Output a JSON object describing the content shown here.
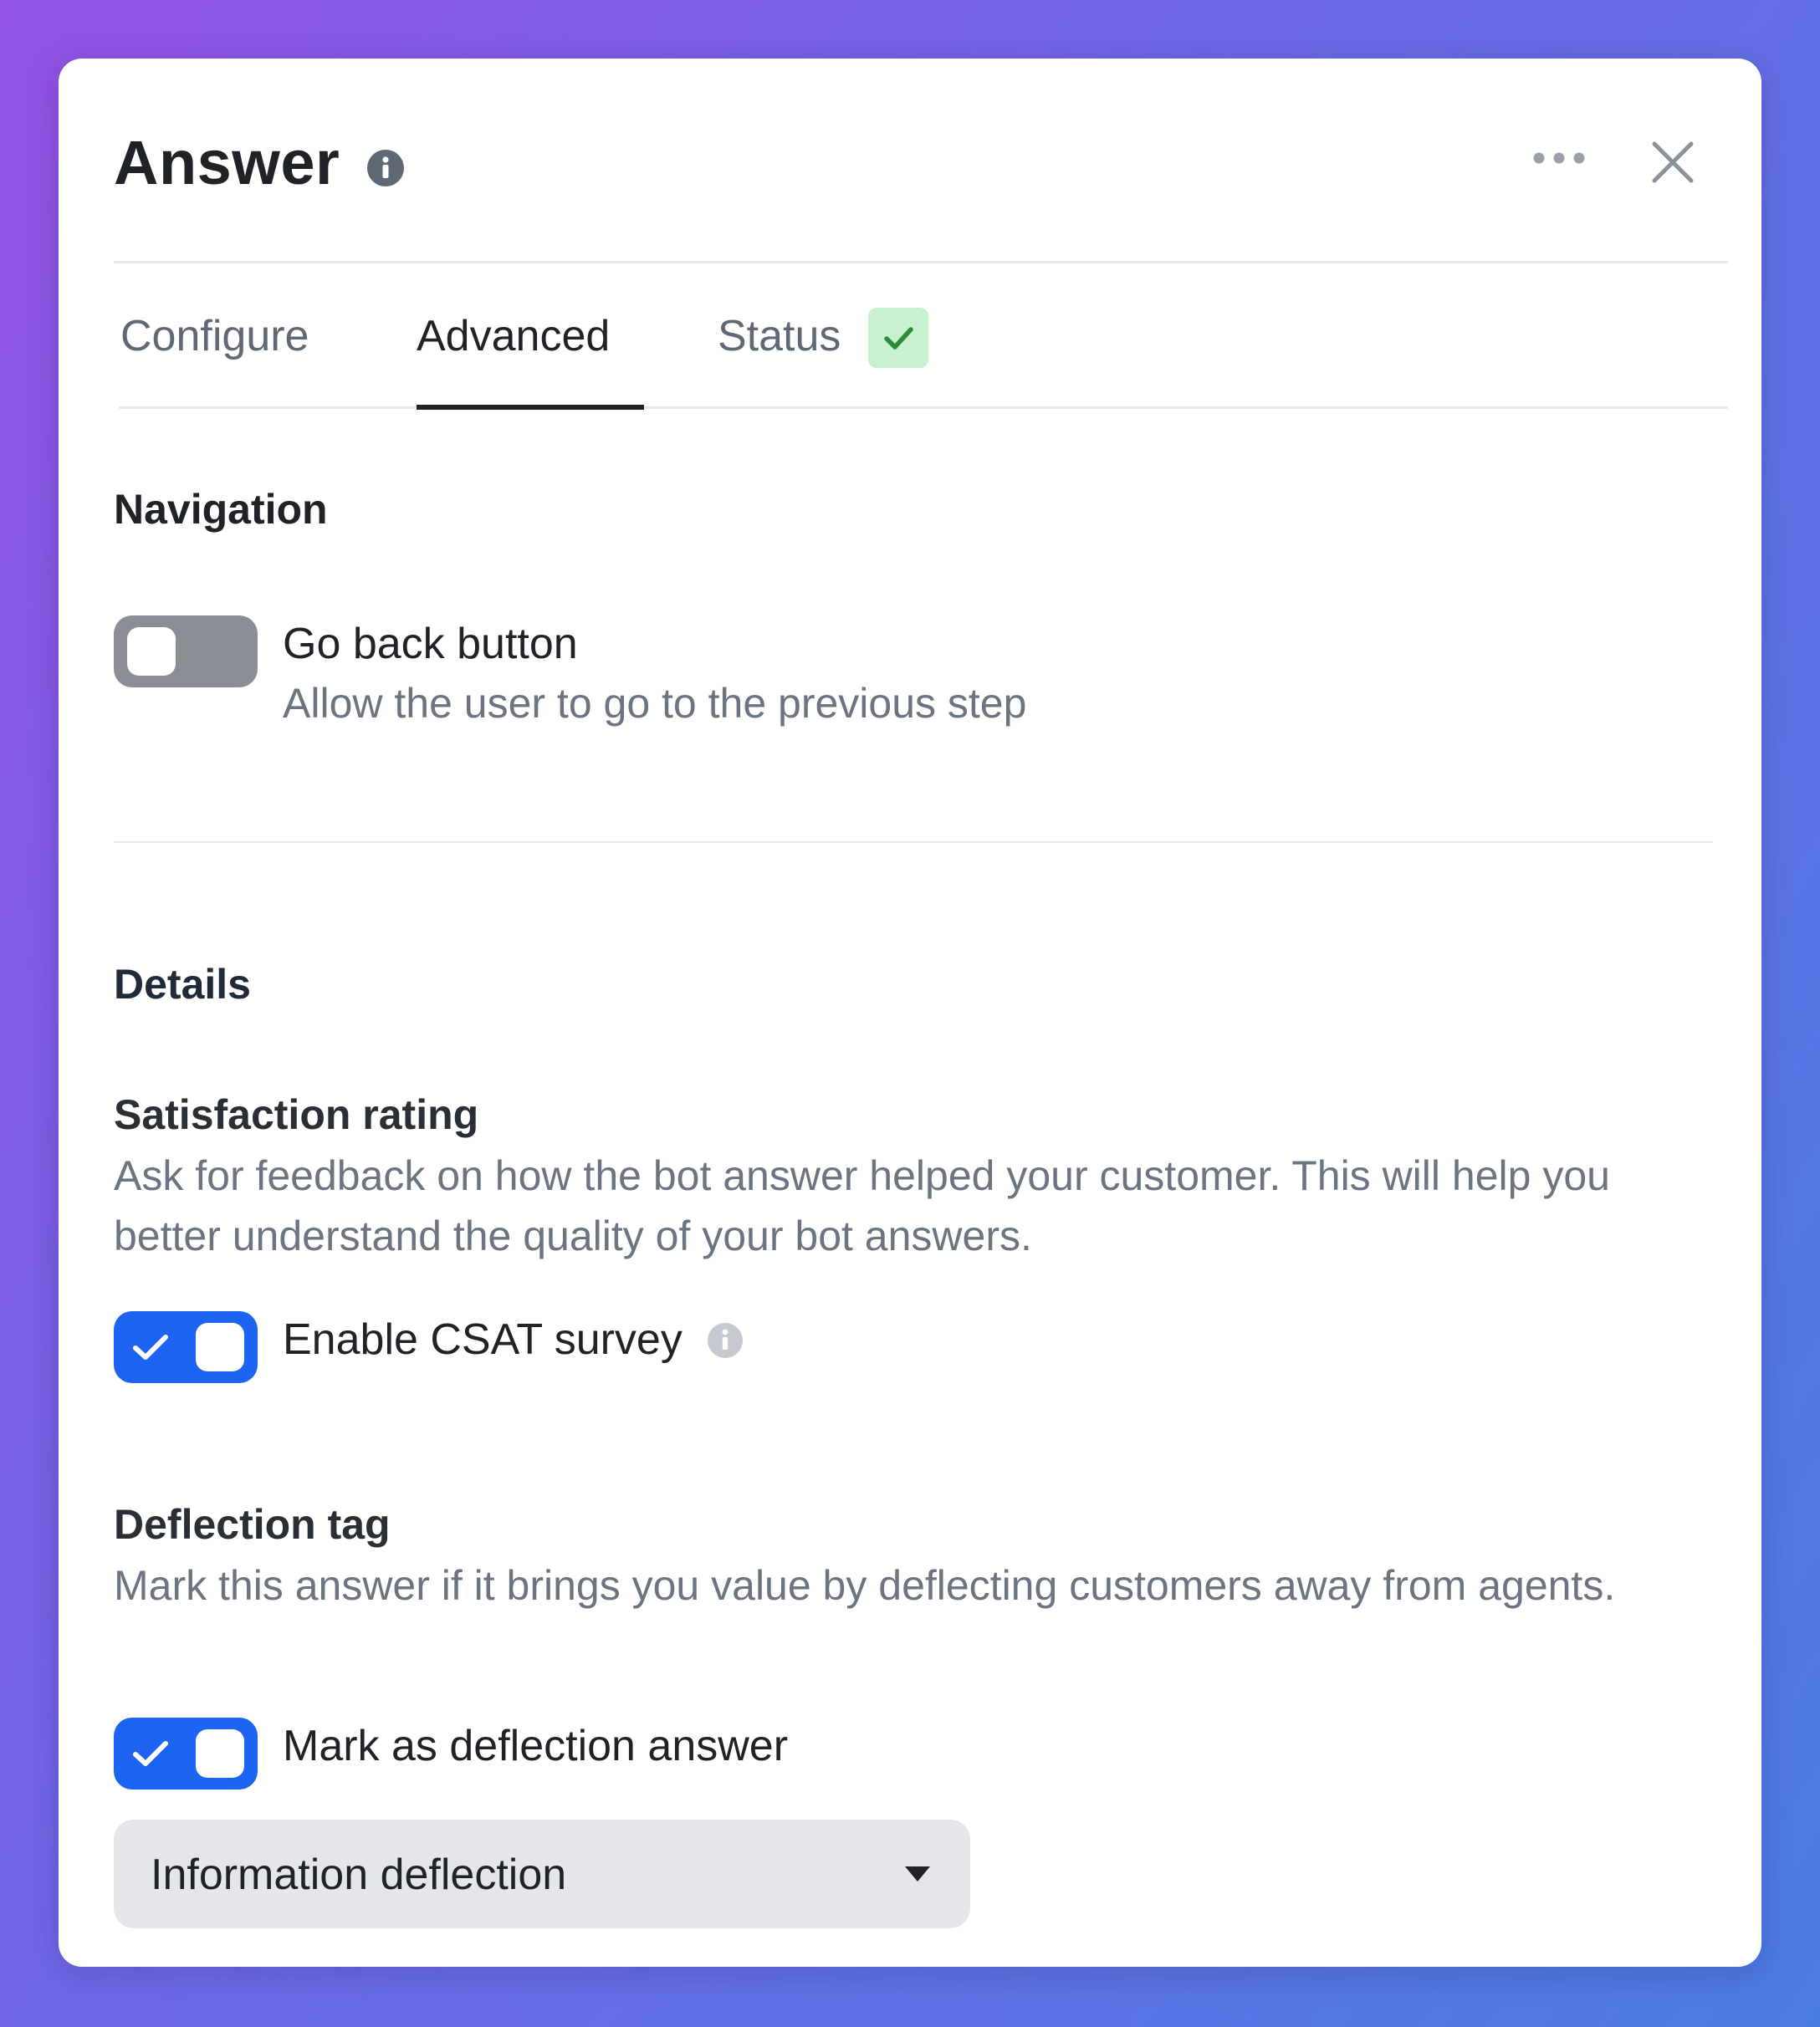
{
  "dialog": {
    "title": "Answer",
    "icons": {
      "title_info": "info-icon",
      "more": "more-horizontal-icon",
      "close": "close-icon"
    }
  },
  "tabs": [
    {
      "label": "Configure",
      "active": false
    },
    {
      "label": "Advanced",
      "active": true
    },
    {
      "label": "Status",
      "active": false,
      "badge_icon": "check-icon"
    }
  ],
  "navigation": {
    "title": "Navigation",
    "go_back": {
      "label": "Go back button",
      "description": "Allow the user to go to the previous step",
      "enabled": false
    }
  },
  "details": {
    "title": "Details",
    "satisfaction": {
      "title": "Satisfaction rating",
      "description": "Ask for feedback on how the bot answer helped your customer. This will help you better understand the quality of your bot answers.",
      "toggle_label": "Enable CSAT survey",
      "enabled": true,
      "info_icon": "info-icon"
    },
    "deflection": {
      "title": "Deflection tag",
      "description": "Mark this answer if it brings you value by deflecting customers away from agents.",
      "toggle_label": "Mark as deflection answer",
      "enabled": true,
      "select_value": "Information deflection",
      "select_icon": "caret-down-icon"
    }
  },
  "colors": {
    "accent": "#1e64f2",
    "toggle_off": "#8b8f95",
    "status_badge_bg": "#c9f0cf",
    "status_badge_check": "#2e8b3e"
  }
}
